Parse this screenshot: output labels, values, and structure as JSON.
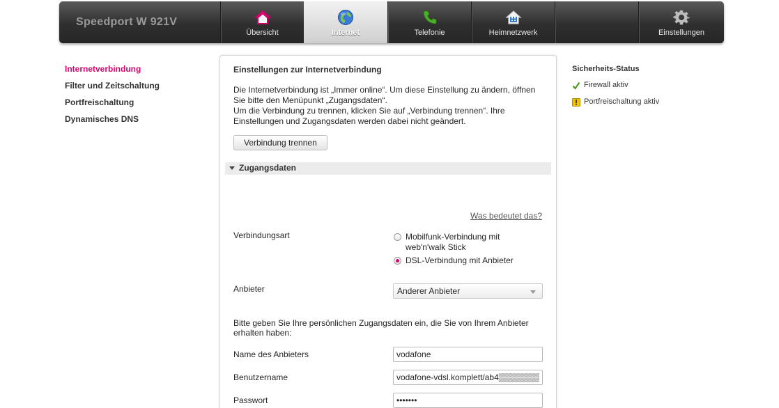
{
  "header": {
    "brand": "Speedport W 921V",
    "tabs": [
      {
        "label": "Übersicht",
        "icon": "house-icon"
      },
      {
        "label": "Internet",
        "icon": "globe-icon",
        "active": true
      },
      {
        "label": "Telefonie",
        "icon": "phone-icon"
      },
      {
        "label": "Heimnetzwerk",
        "icon": "home-network-icon"
      },
      {
        "label": "",
        "icon": ""
      },
      {
        "label": "Einstellungen",
        "icon": "gear-icon"
      }
    ]
  },
  "sidebar": {
    "items": [
      {
        "label": "Internetverbindung",
        "active": true
      },
      {
        "label": "Filter und Zeitschaltung"
      },
      {
        "label": "Portfreischaltung"
      },
      {
        "label": "Dynamisches DNS"
      }
    ]
  },
  "main": {
    "title": "Einstellungen zur Internetverbindung",
    "intro_line1": "Die Internetverbindung ist „Immer online“. Um diese Einstellung zu ändern, öffnen Sie bitte den Menüpunkt „Zugangsdaten“.",
    "intro_line2": "Um die Verbindung zu trennen, klicken Sie auf „Verbindung trennen“. Ihre Einstellungen und Zugangsdaten werden dabei nicht geändert.",
    "disconnect_button": "Verbindung trennen",
    "section_title": "Zugangsdaten",
    "help_link": "Was bedeutet das?",
    "connection_type": {
      "label": "Verbindungsart",
      "options": [
        {
          "label": "Mobilfunk-Verbindung mit web'n'walk Stick",
          "checked": false
        },
        {
          "label": "DSL-Verbindung mit Anbieter",
          "checked": true
        }
      ]
    },
    "provider": {
      "label": "Anbieter",
      "selected": "Anderer Anbieter"
    },
    "credentials_info": "Bitte geben Sie Ihre persönlichen Zugangsdaten ein, die Sie von Ihrem Anbieter erhalten haben:",
    "fields": {
      "provider_name": {
        "label": "Name des Anbieters",
        "value": "vodafone"
      },
      "username": {
        "label": "Benutzername",
        "value": "vodafone-vdsl.komplett/ab4▒▒▒▒▒▒▒"
      },
      "password": {
        "label": "Passwort",
        "value": "•••••••"
      }
    }
  },
  "security": {
    "title": "Sicherheits-Status",
    "items": [
      {
        "label": "Firewall aktiv",
        "icon": "checkmark-icon",
        "color": "#4e9a1f"
      },
      {
        "label": "Portfreischaltung aktiv",
        "icon": "warning-icon",
        "color": "#e6b800"
      }
    ]
  },
  "colors": {
    "accent": "#d4076f",
    "header_dark": "#2f2f2f"
  }
}
